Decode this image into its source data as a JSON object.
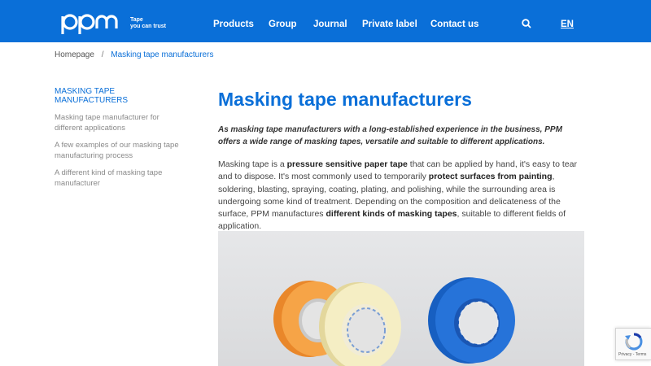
{
  "brand": {
    "logo_text": "ppm",
    "tagline_line1": "Tape",
    "tagline_line2": "you can trust"
  },
  "nav": {
    "items": [
      "Products",
      "Group",
      "Journal",
      "Private label",
      "Contact us"
    ],
    "search_icon": "search-icon",
    "language": "EN"
  },
  "breadcrumb": {
    "home": "Homepage",
    "separator": "/",
    "current": "Masking tape manufacturers"
  },
  "sidebar": {
    "active": "MASKING TAPE MANUFACTURERS",
    "items": [
      "Masking tape manufacturer for different applications",
      "A few examples of our masking tape manufacturing process",
      "A different kind of masking tape manufacturer"
    ]
  },
  "main": {
    "title": "Masking tape manufacturers",
    "lead": "As masking tape manufacturers with a long-established experience in the business, PPM offers a wide range of masking tapes, versatile and suitable to different applications.",
    "para": {
      "t1": "Masking tape is a ",
      "b1": "pressure sensitive paper tape",
      "t2": " that can be applied by hand, it's easy to tear and to dispose. It's most commonly used to temporarily ",
      "b2": "protect surfaces from painting",
      "t3": ", soldering, blasting, spraying, coating, plating, and polishing, while the surrounding area is undergoing some kind of treatment. Depending on the composition and delicateness of the surface, PPM manufactures ",
      "b3": "different kinds of masking tapes",
      "t4": ", suitable to different fields of application."
    },
    "hero_image": "masking-tape-rolls-photo"
  },
  "recaptcha": {
    "label": "Privacy - Terms"
  },
  "colors": {
    "brand_blue": "#0a6fd8",
    "orange_tape": "#f49a35",
    "cream_tape": "#f3e9b8",
    "blue_tape": "#1f6fd6"
  }
}
